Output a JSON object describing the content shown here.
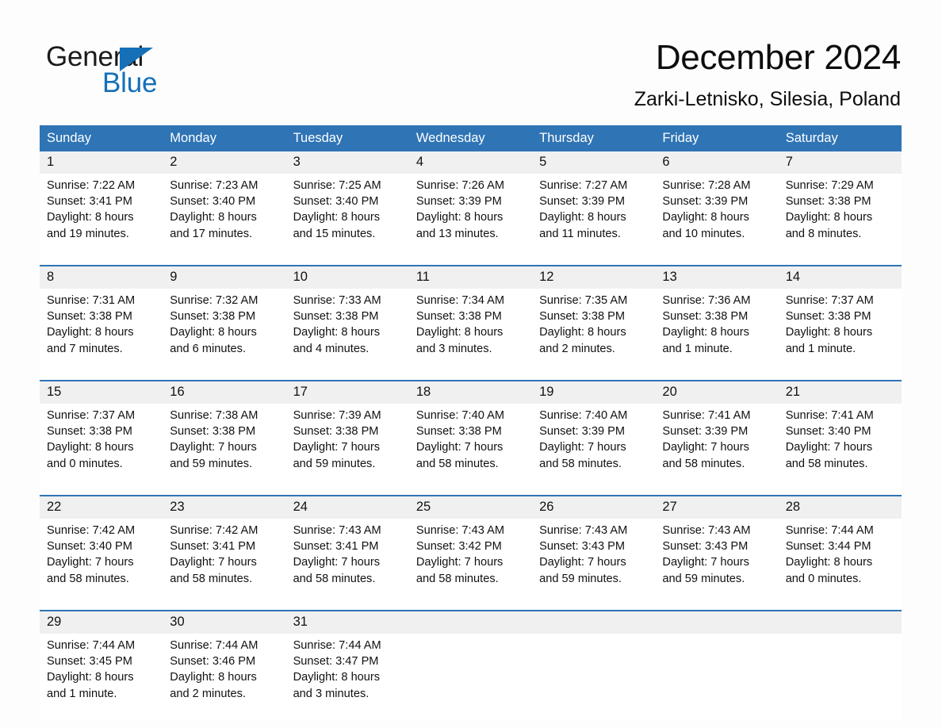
{
  "brand": {
    "name_top": "General",
    "name_bottom": "Blue",
    "accent_color": "#1570b8",
    "triangle_icon": "brand-triangle-icon"
  },
  "header": {
    "title": "December 2024",
    "subtitle": "Zarki-Letnisko, Silesia, Poland"
  },
  "calendar": {
    "header_bg": "#2f74b5",
    "daynum_bg": "#f0f0f0",
    "weekday_headers": [
      "Sunday",
      "Monday",
      "Tuesday",
      "Wednesday",
      "Thursday",
      "Friday",
      "Saturday"
    ],
    "weeks": [
      {
        "days": [
          {
            "date": "1",
            "sunrise": "Sunrise: 7:22 AM",
            "sunset": "Sunset: 3:41 PM",
            "daylight_1": "Daylight: 8 hours",
            "daylight_2": "and 19 minutes."
          },
          {
            "date": "2",
            "sunrise": "Sunrise: 7:23 AM",
            "sunset": "Sunset: 3:40 PM",
            "daylight_1": "Daylight: 8 hours",
            "daylight_2": "and 17 minutes."
          },
          {
            "date": "3",
            "sunrise": "Sunrise: 7:25 AM",
            "sunset": "Sunset: 3:40 PM",
            "daylight_1": "Daylight: 8 hours",
            "daylight_2": "and 15 minutes."
          },
          {
            "date": "4",
            "sunrise": "Sunrise: 7:26 AM",
            "sunset": "Sunset: 3:39 PM",
            "daylight_1": "Daylight: 8 hours",
            "daylight_2": "and 13 minutes."
          },
          {
            "date": "5",
            "sunrise": "Sunrise: 7:27 AM",
            "sunset": "Sunset: 3:39 PM",
            "daylight_1": "Daylight: 8 hours",
            "daylight_2": "and 11 minutes."
          },
          {
            "date": "6",
            "sunrise": "Sunrise: 7:28 AM",
            "sunset": "Sunset: 3:39 PM",
            "daylight_1": "Daylight: 8 hours",
            "daylight_2": "and 10 minutes."
          },
          {
            "date": "7",
            "sunrise": "Sunrise: 7:29 AM",
            "sunset": "Sunset: 3:38 PM",
            "daylight_1": "Daylight: 8 hours",
            "daylight_2": "and 8 minutes."
          }
        ]
      },
      {
        "days": [
          {
            "date": "8",
            "sunrise": "Sunrise: 7:31 AM",
            "sunset": "Sunset: 3:38 PM",
            "daylight_1": "Daylight: 8 hours",
            "daylight_2": "and 7 minutes."
          },
          {
            "date": "9",
            "sunrise": "Sunrise: 7:32 AM",
            "sunset": "Sunset: 3:38 PM",
            "daylight_1": "Daylight: 8 hours",
            "daylight_2": "and 6 minutes."
          },
          {
            "date": "10",
            "sunrise": "Sunrise: 7:33 AM",
            "sunset": "Sunset: 3:38 PM",
            "daylight_1": "Daylight: 8 hours",
            "daylight_2": "and 4 minutes."
          },
          {
            "date": "11",
            "sunrise": "Sunrise: 7:34 AM",
            "sunset": "Sunset: 3:38 PM",
            "daylight_1": "Daylight: 8 hours",
            "daylight_2": "and 3 minutes."
          },
          {
            "date": "12",
            "sunrise": "Sunrise: 7:35 AM",
            "sunset": "Sunset: 3:38 PM",
            "daylight_1": "Daylight: 8 hours",
            "daylight_2": "and 2 minutes."
          },
          {
            "date": "13",
            "sunrise": "Sunrise: 7:36 AM",
            "sunset": "Sunset: 3:38 PM",
            "daylight_1": "Daylight: 8 hours",
            "daylight_2": "and 1 minute."
          },
          {
            "date": "14",
            "sunrise": "Sunrise: 7:37 AM",
            "sunset": "Sunset: 3:38 PM",
            "daylight_1": "Daylight: 8 hours",
            "daylight_2": "and 1 minute."
          }
        ]
      },
      {
        "days": [
          {
            "date": "15",
            "sunrise": "Sunrise: 7:37 AM",
            "sunset": "Sunset: 3:38 PM",
            "daylight_1": "Daylight: 8 hours",
            "daylight_2": "and 0 minutes."
          },
          {
            "date": "16",
            "sunrise": "Sunrise: 7:38 AM",
            "sunset": "Sunset: 3:38 PM",
            "daylight_1": "Daylight: 7 hours",
            "daylight_2": "and 59 minutes."
          },
          {
            "date": "17",
            "sunrise": "Sunrise: 7:39 AM",
            "sunset": "Sunset: 3:38 PM",
            "daylight_1": "Daylight: 7 hours",
            "daylight_2": "and 59 minutes."
          },
          {
            "date": "18",
            "sunrise": "Sunrise: 7:40 AM",
            "sunset": "Sunset: 3:38 PM",
            "daylight_1": "Daylight: 7 hours",
            "daylight_2": "and 58 minutes."
          },
          {
            "date": "19",
            "sunrise": "Sunrise: 7:40 AM",
            "sunset": "Sunset: 3:39 PM",
            "daylight_1": "Daylight: 7 hours",
            "daylight_2": "and 58 minutes."
          },
          {
            "date": "20",
            "sunrise": "Sunrise: 7:41 AM",
            "sunset": "Sunset: 3:39 PM",
            "daylight_1": "Daylight: 7 hours",
            "daylight_2": "and 58 minutes."
          },
          {
            "date": "21",
            "sunrise": "Sunrise: 7:41 AM",
            "sunset": "Sunset: 3:40 PM",
            "daylight_1": "Daylight: 7 hours",
            "daylight_2": "and 58 minutes."
          }
        ]
      },
      {
        "days": [
          {
            "date": "22",
            "sunrise": "Sunrise: 7:42 AM",
            "sunset": "Sunset: 3:40 PM",
            "daylight_1": "Daylight: 7 hours",
            "daylight_2": "and 58 minutes."
          },
          {
            "date": "23",
            "sunrise": "Sunrise: 7:42 AM",
            "sunset": "Sunset: 3:41 PM",
            "daylight_1": "Daylight: 7 hours",
            "daylight_2": "and 58 minutes."
          },
          {
            "date": "24",
            "sunrise": "Sunrise: 7:43 AM",
            "sunset": "Sunset: 3:41 PM",
            "daylight_1": "Daylight: 7 hours",
            "daylight_2": "and 58 minutes."
          },
          {
            "date": "25",
            "sunrise": "Sunrise: 7:43 AM",
            "sunset": "Sunset: 3:42 PM",
            "daylight_1": "Daylight: 7 hours",
            "daylight_2": "and 58 minutes."
          },
          {
            "date": "26",
            "sunrise": "Sunrise: 7:43 AM",
            "sunset": "Sunset: 3:43 PM",
            "daylight_1": "Daylight: 7 hours",
            "daylight_2": "and 59 minutes."
          },
          {
            "date": "27",
            "sunrise": "Sunrise: 7:43 AM",
            "sunset": "Sunset: 3:43 PM",
            "daylight_1": "Daylight: 7 hours",
            "daylight_2": "and 59 minutes."
          },
          {
            "date": "28",
            "sunrise": "Sunrise: 7:44 AM",
            "sunset": "Sunset: 3:44 PM",
            "daylight_1": "Daylight: 8 hours",
            "daylight_2": "and 0 minutes."
          }
        ]
      },
      {
        "days": [
          {
            "date": "29",
            "sunrise": "Sunrise: 7:44 AM",
            "sunset": "Sunset: 3:45 PM",
            "daylight_1": "Daylight: 8 hours",
            "daylight_2": "and 1 minute."
          },
          {
            "date": "30",
            "sunrise": "Sunrise: 7:44 AM",
            "sunset": "Sunset: 3:46 PM",
            "daylight_1": "Daylight: 8 hours",
            "daylight_2": "and 2 minutes."
          },
          {
            "date": "31",
            "sunrise": "Sunrise: 7:44 AM",
            "sunset": "Sunset: 3:47 PM",
            "daylight_1": "Daylight: 8 hours",
            "daylight_2": "and 3 minutes."
          },
          {
            "date": "",
            "sunrise": "",
            "sunset": "",
            "daylight_1": "",
            "daylight_2": ""
          },
          {
            "date": "",
            "sunrise": "",
            "sunset": "",
            "daylight_1": "",
            "daylight_2": ""
          },
          {
            "date": "",
            "sunrise": "",
            "sunset": "",
            "daylight_1": "",
            "daylight_2": ""
          },
          {
            "date": "",
            "sunrise": "",
            "sunset": "",
            "daylight_1": "",
            "daylight_2": ""
          }
        ]
      }
    ]
  }
}
